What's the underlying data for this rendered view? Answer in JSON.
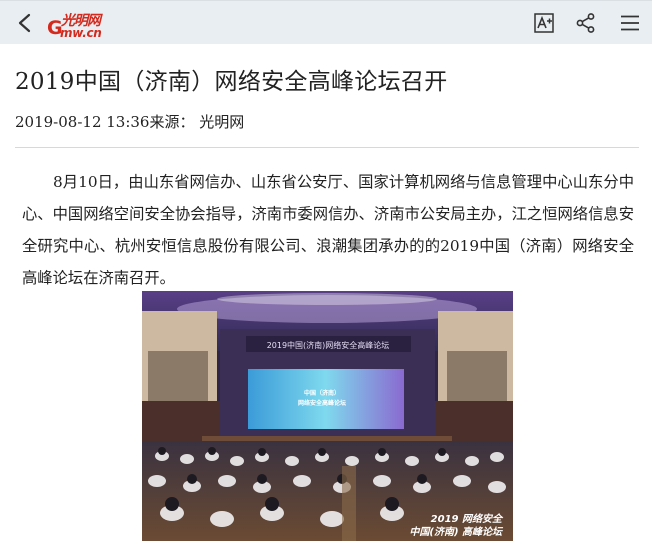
{
  "header": {
    "logo": {
      "letter": "G",
      "domain": "mw.cn",
      "script": "光明网"
    },
    "icons": [
      "back-icon",
      "font-size-icon",
      "share-icon",
      "menu-icon"
    ]
  },
  "article": {
    "title": "2019中国（济南）网络安全高峰论坛召开",
    "meta": "2019-08-12 13:36来源： 光明网",
    "paragraph": "8月10日，由山东省网信办、山东省公安厅、国家计算机网络与信息管理中心山东分中心、中国网络空间安全协会指导，济南市委网信办、济南市公安局主办，江之恒网络信息安全研究中心、杭州安恒信息股份有限公司、浪潮集团承办的的2019中国（济南）网络安全高峰论坛在济南召开。",
    "photo": {
      "banner": "2019中国(济南)网络安全高峰论坛",
      "screen_line1": "中国（济南）",
      "screen_line2": "网络安全高峰论坛",
      "watermark_line1": "2019 网络安全",
      "watermark_line2": "中国(济南) 高峰论坛"
    }
  },
  "colors": {
    "brand_red": "#d42a1e",
    "header_bg": "#e8eef1",
    "icon": "#333333"
  }
}
